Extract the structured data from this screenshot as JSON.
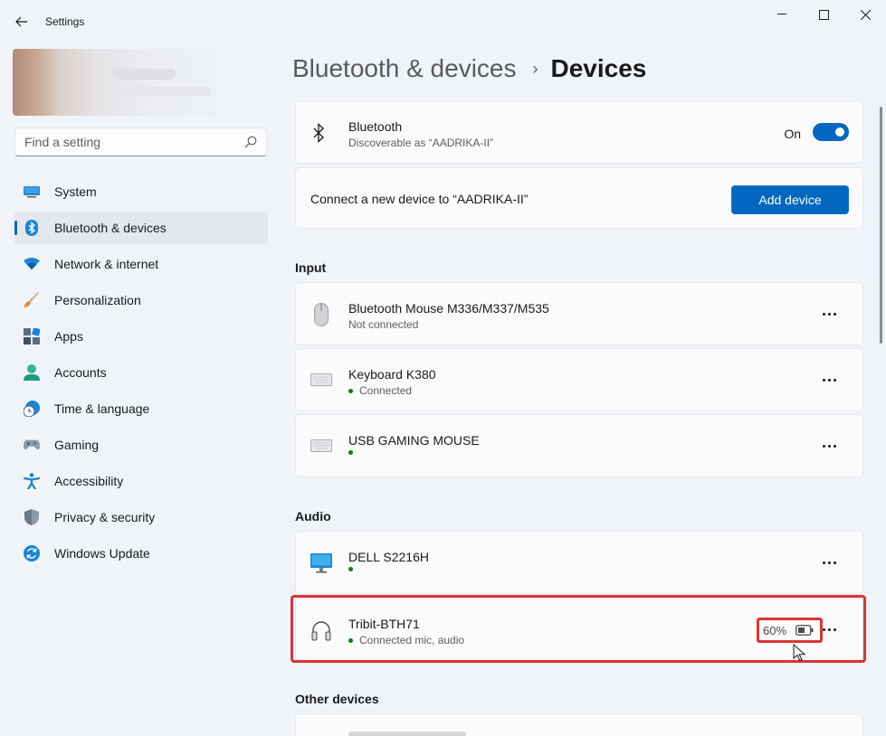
{
  "window": {
    "title": "Settings"
  },
  "sidebar": {
    "search_placeholder": "Find a setting",
    "items": [
      {
        "label": "System",
        "icon": "monitor-icon"
      },
      {
        "label": "Bluetooth & devices",
        "icon": "bluetooth-icon",
        "active": true
      },
      {
        "label": "Network & internet",
        "icon": "wifi-icon"
      },
      {
        "label": "Personalization",
        "icon": "brush-icon"
      },
      {
        "label": "Apps",
        "icon": "apps-icon"
      },
      {
        "label": "Accounts",
        "icon": "person-icon"
      },
      {
        "label": "Time & language",
        "icon": "globe-clock-icon"
      },
      {
        "label": "Gaming",
        "icon": "gamepad-icon"
      },
      {
        "label": "Accessibility",
        "icon": "accessibility-icon"
      },
      {
        "label": "Privacy & security",
        "icon": "shield-icon"
      },
      {
        "label": "Windows Update",
        "icon": "update-icon"
      }
    ]
  },
  "breadcrumb": {
    "parent": "Bluetooth & devices",
    "separator": "›",
    "current": "Devices"
  },
  "bluetooth": {
    "title": "Bluetooth",
    "subtitle": "Discoverable as “AADRIKA-II”",
    "toggle_label": "On",
    "toggle_on": true
  },
  "connect": {
    "text": "Connect a new device to “AADRIKA-II”",
    "button": "Add device"
  },
  "sections": {
    "input": "Input",
    "audio": "Audio",
    "other": "Other devices"
  },
  "input_devices": [
    {
      "name": "Bluetooth Mouse M336/M337/M535",
      "status": "Not connected",
      "icon": "mouse-icon"
    },
    {
      "name": "Keyboard K380",
      "status": "Connected",
      "icon": "keyboard-icon"
    },
    {
      "name": "USB GAMING MOUSE",
      "status": "",
      "icon": "keyboard-icon"
    }
  ],
  "audio_devices": [
    {
      "name": "DELL S2216H",
      "status": "",
      "icon": "monitor-icon"
    },
    {
      "name": "Tribit-BTH71",
      "status": "Connected mic, audio",
      "icon": "headphones-icon",
      "battery": "60%"
    }
  ],
  "colors": {
    "accent": "#0067c0",
    "highlight": "#dd3434",
    "connected_dot": "#0f7b0f"
  }
}
